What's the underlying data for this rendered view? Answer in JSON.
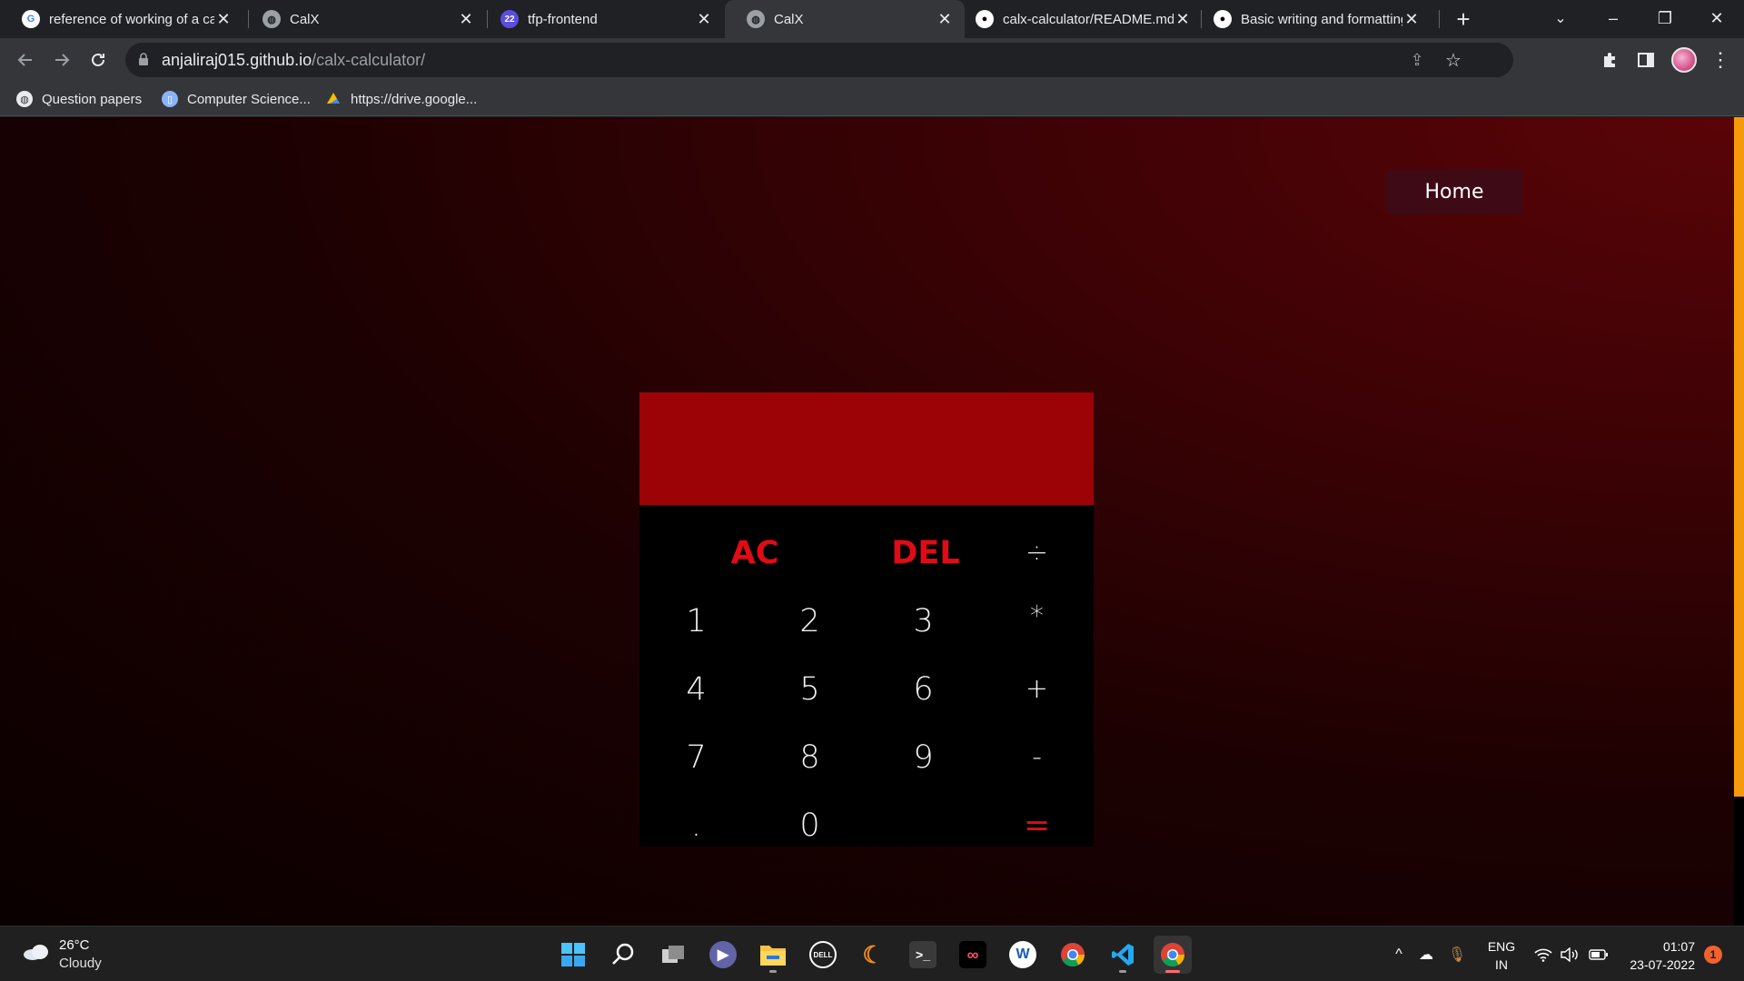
{
  "browser": {
    "tabs": [
      {
        "title": "reference of working of a calc",
        "icon": "google-icon"
      },
      {
        "title": "CalX",
        "icon": "globe-icon"
      },
      {
        "title": "tfp-frontend",
        "icon": "app-icon",
        "icon_text": "22"
      },
      {
        "title": "CalX",
        "icon": "globe-icon",
        "active": true
      },
      {
        "title": "calx-calculator/README.md",
        "icon": "github-icon"
      },
      {
        "title": "Basic writing and formatting",
        "icon": "github-icon"
      }
    ],
    "new_tab_symbol": "+",
    "window_controls": {
      "minimize": "–",
      "restore": "❐",
      "close": "✕",
      "tab_search": "⌄"
    },
    "url": {
      "host": "anjaliraj015.github.io",
      "path": "/calx-calculator/"
    },
    "bookmarks": [
      {
        "label": "Question papers",
        "icon": "globe-icon"
      },
      {
        "label": "Computer Science...",
        "icon": "app-icon"
      },
      {
        "label": "https://drive.google...",
        "icon": "google-drive-icon"
      }
    ]
  },
  "page": {
    "home_button": "Home",
    "display_value": "",
    "keys": [
      {
        "label": "AC",
        "kind": "clear"
      },
      {
        "label": "DEL",
        "kind": "delete"
      },
      {
        "label": "÷",
        "kind": "operator"
      },
      {
        "label": "1",
        "kind": "digit"
      },
      {
        "label": "2",
        "kind": "digit"
      },
      {
        "label": "3",
        "kind": "digit"
      },
      {
        "label": "*",
        "kind": "operator"
      },
      {
        "label": "4",
        "kind": "digit"
      },
      {
        "label": "5",
        "kind": "digit"
      },
      {
        "label": "6",
        "kind": "digit"
      },
      {
        "label": "+",
        "kind": "operator"
      },
      {
        "label": "7",
        "kind": "digit"
      },
      {
        "label": "8",
        "kind": "digit"
      },
      {
        "label": "9",
        "kind": "digit"
      },
      {
        "label": "-",
        "kind": "operator"
      },
      {
        "label": ".",
        "kind": "decimal"
      },
      {
        "label": "0",
        "kind": "digit"
      },
      {
        "label": "=",
        "kind": "equals"
      }
    ],
    "colors": {
      "display": "#9b0306",
      "keypad": "#000000",
      "accent_red": "#e00b14",
      "home_button": "#3e0a16",
      "scrollbar": "#f59a0a"
    }
  },
  "taskbar": {
    "weather": {
      "temp": "26°C",
      "condition": "Cloudy"
    },
    "apps": [
      "windows-start-icon",
      "search-icon",
      "task-view-icon",
      "teams-chat-icon",
      "file-explorer-icon",
      "dell-icon",
      "eclipse-icon",
      "terminal-icon",
      "creative-cloud-icon",
      "word-icon",
      "chrome-icon",
      "vscode-icon",
      "chrome-icon"
    ],
    "language": {
      "line1": "ENG",
      "line2": "IN"
    },
    "clock": {
      "time": "01:07",
      "date": "23-07-2022"
    },
    "notification_count": "1"
  }
}
